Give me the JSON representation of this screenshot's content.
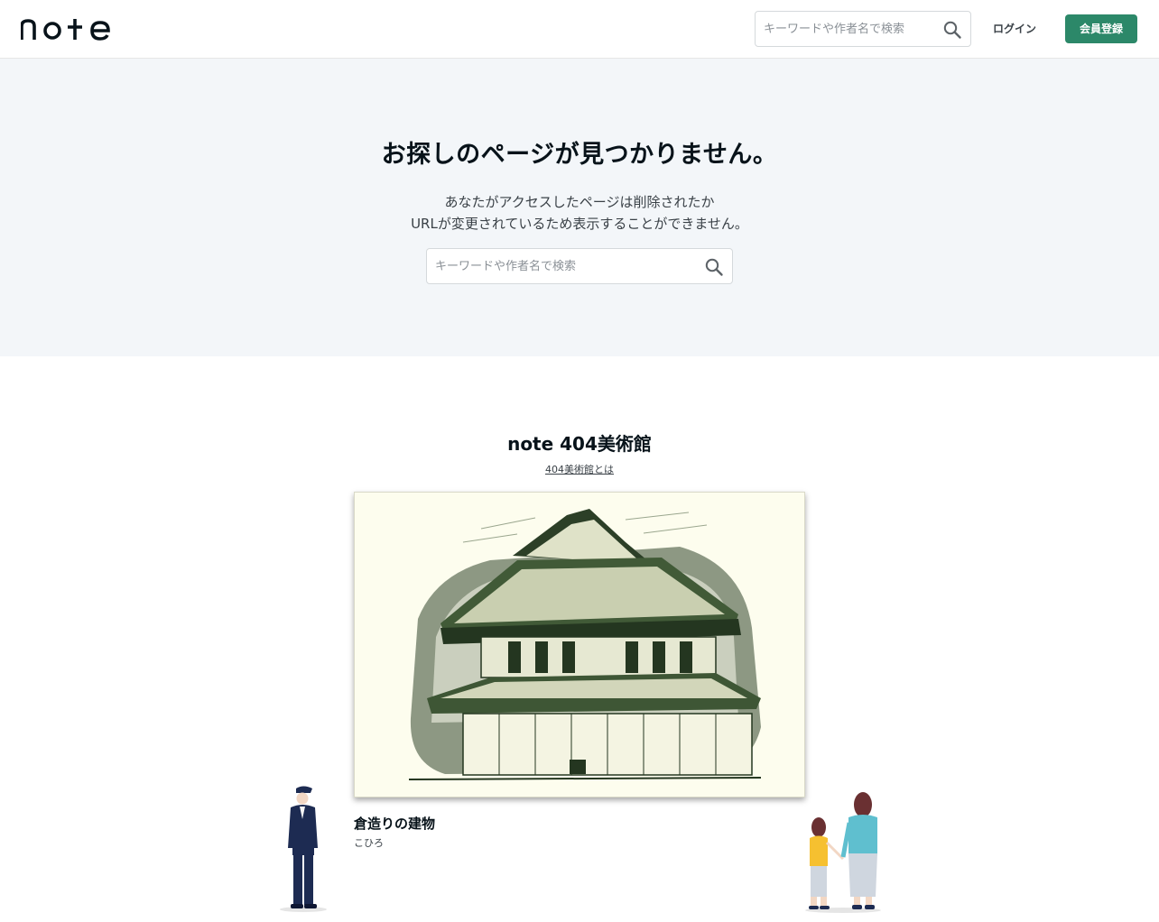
{
  "header": {
    "logo_text": "note",
    "search_placeholder": "キーワードや作者名で検索",
    "login_label": "ログイン",
    "signup_label": "会員登録"
  },
  "hero": {
    "title": "お探しのページが見つかりません。",
    "desc_line1": "あなたがアクセスしたページは削除されたか",
    "desc_line2": "URLが変更されているため表示することができません。",
    "search_placeholder": "キーワードや作者名で検索"
  },
  "museum": {
    "title": "note 404美術館",
    "link_label": "404美術館とは",
    "artwork_title": "倉造りの建物",
    "artwork_author": "こひろ"
  },
  "colors": {
    "accent": "#2c8869",
    "hero_bg": "#f3f6f9",
    "artwork_bg": "#fdfdee",
    "ink": "#0f2a14"
  },
  "icons": {
    "header_search": "search-icon",
    "main_search": "search-icon"
  }
}
